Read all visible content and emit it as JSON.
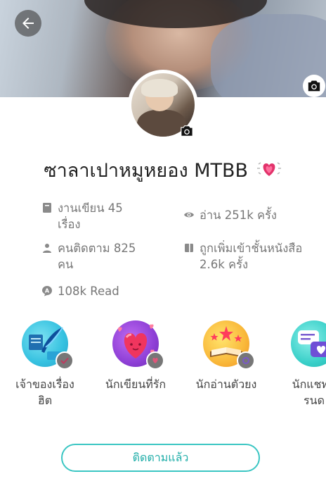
{
  "header": {
    "back_icon": "arrow-left-icon",
    "cover_camera_icon": "camera-icon"
  },
  "profile": {
    "name": "ซาลาเปาหมูหยอง MTBB",
    "name_emoji": "sparkling-heart-icon",
    "avatar_camera_icon": "camera-icon"
  },
  "stats": [
    {
      "icon": "book-icon",
      "text": "งานเขียน 45\nเรื่อง"
    },
    {
      "icon": "eye-icon",
      "text": "อ่าน 251k ครั้ง"
    },
    {
      "icon": "person-icon",
      "text": "คนติดตาม 825\nคน"
    },
    {
      "icon": "bookshelf-icon",
      "text": "ถูกเพิ่มเข้าชั้นหนังสือ\n2.6k ครั้ง"
    },
    {
      "icon": "read-badge-icon",
      "text": "108k Read"
    }
  ],
  "badges": [
    {
      "label": "เจ้าของเรื่อง\nฮิต",
      "icon": "quill-badge-icon",
      "color": "#35c1e0"
    },
    {
      "label": "นักเขียนที่รัก",
      "icon": "heart-badge-icon",
      "color": "#8e3fd6"
    },
    {
      "label": "นักอ่านตัวยง",
      "icon": "book-stars-badge-icon",
      "color": "#f5a623"
    },
    {
      "label": "นักแชทตั\nรนด",
      "icon": "chat-badge-icon",
      "color": "#3ad0c9"
    }
  ],
  "actions": {
    "follow_label": "ติดตามแล้ว"
  },
  "colors": {
    "accent": "#3bc6c3",
    "accent_text": "#21aea9"
  }
}
